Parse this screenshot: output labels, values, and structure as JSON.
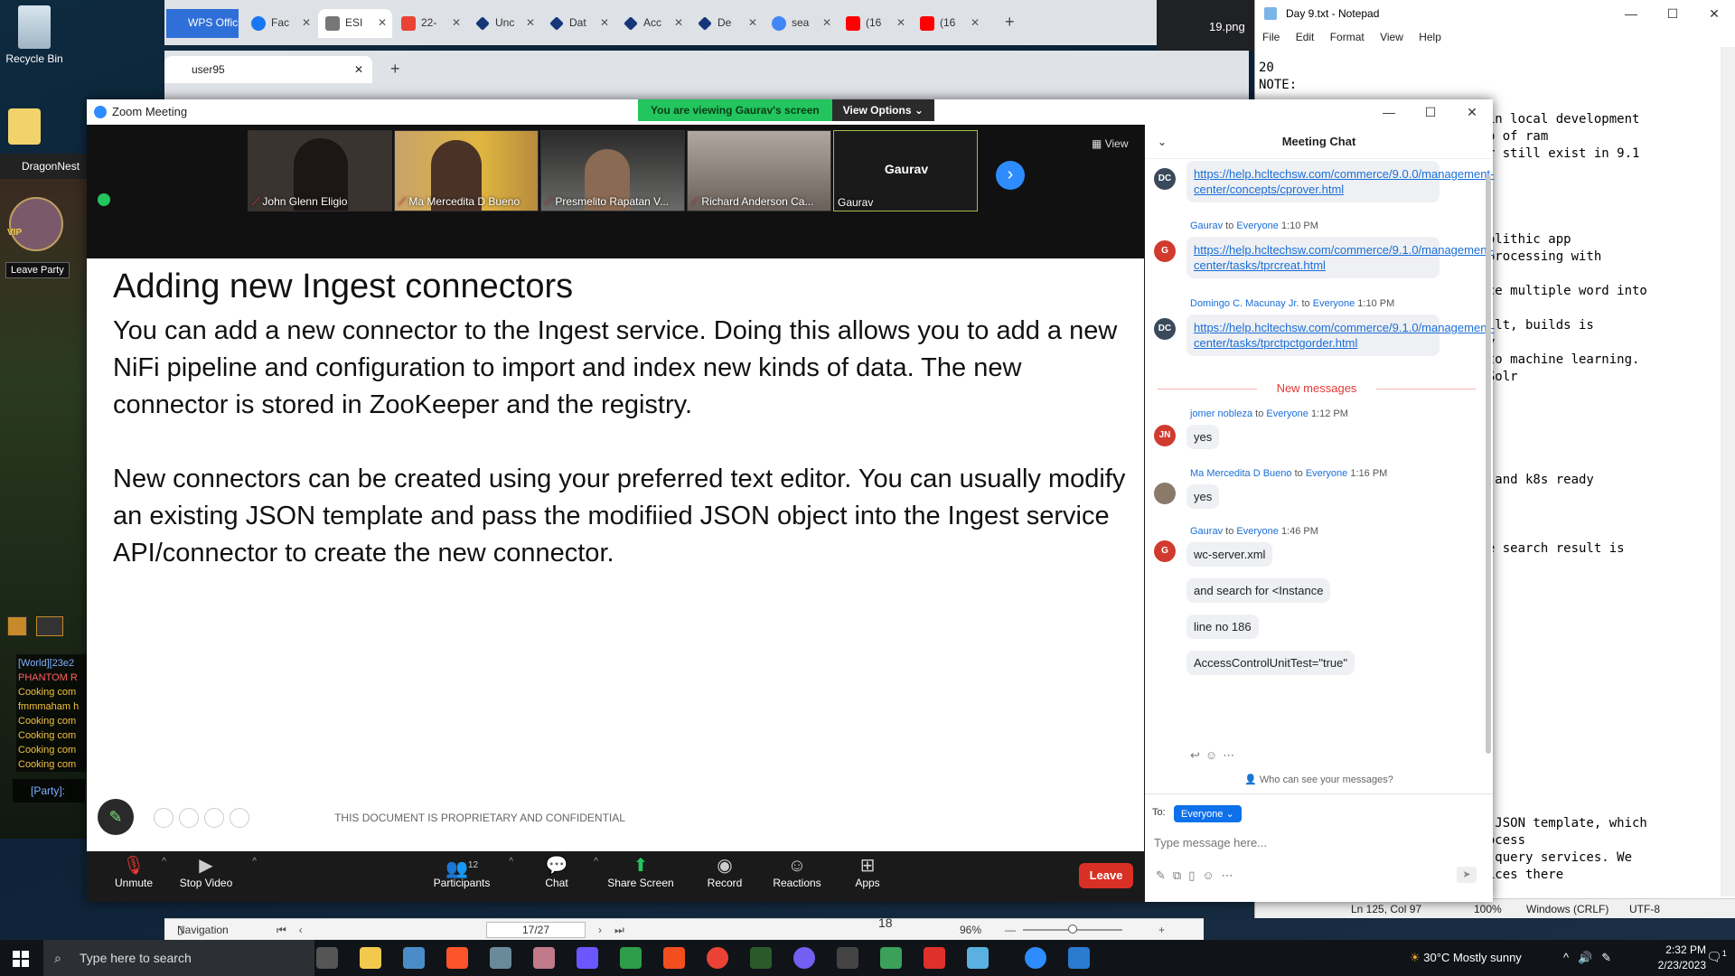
{
  "desktop": {
    "recycle_bin": "Recycle Bin",
    "dragonnest": "DragonNest",
    "leave_party": "Leave Party",
    "vip": "VIP",
    "game_chat": [
      "[World][23e2",
      "PHANTOM R",
      "Cooking com",
      "fmmmaham h",
      "Cooking com",
      "Cooking com",
      "Cooking com",
      "Cooking com"
    ],
    "party_label": "[Party]:"
  },
  "browser": {
    "tabs": [
      {
        "label": "WPS Offici",
        "color": "#2f6fd8"
      },
      {
        "label": "Fac",
        "color": "#1877f2"
      },
      {
        "label": "ESI",
        "color": "#777777"
      },
      {
        "label": "22-",
        "color": "#ea4335"
      },
      {
        "label": "Unc",
        "color": "#16367a"
      },
      {
        "label": "Dat",
        "color": "#16367a"
      },
      {
        "label": "Acc",
        "color": "#16367a"
      },
      {
        "label": "De",
        "color": "#16367a"
      },
      {
        "label": "sea",
        "color": "#4285f4"
      },
      {
        "label": "(16",
        "color": "#ff0000"
      },
      {
        "label": "(16",
        "color": "#ff0000"
      }
    ],
    "second_tab": "user95",
    "image_tab": "19.png"
  },
  "notepad": {
    "title": "Day 9.txt - Notepad",
    "menu": [
      "File",
      "Edit",
      "Format",
      "View",
      "Help"
    ],
    "lines": [
      "20",
      "NOTE:",
      "",
      "                           un in local development",
      "                           80gb of ram",
      "                           Solr still exist in 9.1",
      "",
      "",
      "",
      "",
      "                           monolithic app",
      "                          age processing with",
      "",
      "                          reduce multiple word into",
      "",
      "                          , built, builds is",
      "                          entry",
      "                          ted to machine learning.",
      "                          the Solr",
      "",
      "",
      "",
      "",
      "",
      "                          des, and k8s ready",
      "",
      "",
      "",
      "                          f the search result is",
      "",
      "",
      "",
      "",
      "",
      "",
      "",
      "",
      "",
      "",
      "",
      "",
      "",
      "",
      "",
      "                          ke a JSON template, which",
      "                          t process",
      "                           the query services. We",
      "                          services there"
    ],
    "status": {
      "pos": "Ln 125, Col 97",
      "zoom": "100%",
      "eol": "Windows (CRLF)",
      "enc": "UTF-8"
    }
  },
  "zoom": {
    "title": "Zoom Meeting",
    "viewing_banner": "You are viewing Gaurav's screen",
    "view_options": "View Options",
    "view_label": "View",
    "participants": [
      {
        "name": "John Glenn Eligio",
        "bg": "#3a3430"
      },
      {
        "name": "Ma Mercedita D Bueno",
        "bg": "#b88a3e"
      },
      {
        "name": "Presmelito Rapatan V...",
        "bg": "#5a5a58"
      },
      {
        "name": "Richard Anderson Ca...",
        "bg": "#8a8078"
      }
    ],
    "active_speaker": {
      "name": "Gaurav",
      "label": "Gaurav"
    },
    "slide": {
      "title": "Adding new Ingest connectors",
      "para1": "You can add a new connector to the Ingest service. Doing this allows you to add a new NiFi pipeline and configuration to import and index new kinds of data. The new connector is stored in ZooKeeper and the registry.",
      "para2": "New connectors can be created using your preferred text editor. You can usually modify an existing JSON template and pass the modifiied JSON object into the Ingest service API/connector to create the new connector.",
      "footer": "THIS DOCUMENT IS PROPRIETARY AND CONFIDENTIAL"
    },
    "controls": {
      "unmute": "Unmute",
      "stop_video": "Stop Video",
      "participants": "Participants",
      "participants_count": "12",
      "chat": "Chat",
      "share_screen": "Share Screen",
      "record": "Record",
      "reactions": "Reactions",
      "apps": "Apps",
      "leave": "Leave"
    },
    "chat": {
      "title": "Meeting Chat",
      "messages": [
        {
          "avatar": "DC",
          "link": "https://help.hcltechsw.com/commerce/9.0.0/management-center/concepts/cprover.html"
        },
        {
          "avatar": "G",
          "sender": "Gaurav",
          "to": "to",
          "audience": "Everyone",
          "time": "1:10 PM",
          "link": "https://help.hcltechsw.com/commerce/9.1.0/management-center/tasks/tprcreat.html"
        },
        {
          "avatar": "DC",
          "sender": "Domingo C. Macunay Jr.",
          "to": "to",
          "audience": "Everyone",
          "time": "1:10 PM",
          "link": "https://help.hcltechsw.com/commerce/9.1.0/management-center/tasks/tprctpctgorder.html"
        },
        {
          "avatar": "JN",
          "sender": "jomer nobleza",
          "to": "to",
          "audience": "Everyone",
          "time": "1:12 PM",
          "text": "yes"
        },
        {
          "avatar": "",
          "sender": "Ma Mercedita D Bueno",
          "to": "to",
          "audience": "Everyone",
          "time": "1:16 PM",
          "text": "yes"
        },
        {
          "avatar": "G",
          "sender": "Gaurav",
          "to": "to",
          "audience": "Everyone",
          "time": "1:46 PM",
          "texts": [
            "wc-server.xml",
            "and search for <Instance",
            "line no 186",
            "AccessControlUnitTest=\"true\""
          ]
        }
      ],
      "new_messages": "New messages",
      "who_can_see": "Who can see your messages?",
      "to_label": "To:",
      "to_value": "Everyone",
      "placeholder": "Type message here..."
    }
  },
  "word": {
    "navigation": "Navigation",
    "page": "17/27",
    "zoom": "96%",
    "page_num": "18"
  },
  "taskbar": {
    "search_placeholder": "Type here to search",
    "weather": "30°C  Mostly sunny",
    "time": "2:32 PM",
    "date": "2/23/2023",
    "notif_count": "1"
  }
}
